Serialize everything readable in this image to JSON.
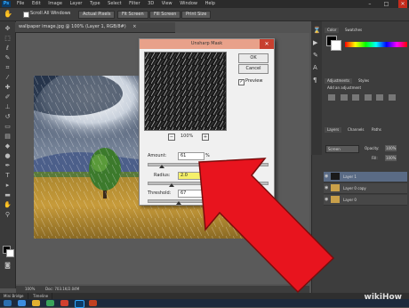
{
  "app": {
    "logo": "Ps",
    "minimize": "–",
    "maximize": "□",
    "close": "✕"
  },
  "menu": [
    "File",
    "Edit",
    "Image",
    "Layer",
    "Type",
    "Select",
    "Filter",
    "3D",
    "View",
    "Window",
    "Help"
  ],
  "options": {
    "scroll_all": "Scroll All Windows",
    "actual_pixels": "Actual Pixels",
    "fit_screen": "Fit Screen",
    "fill_screen": "Fill Screen",
    "print_size": "Print Size"
  },
  "document": {
    "tab_title": "wallpaper image.jpg @ 100% (Layer 1, RGB/8#)",
    "tab_close": "×",
    "status_zoom": "100%",
    "status_doc": "Doc: 703.1K/2.04M"
  },
  "dialog": {
    "title": "Unsharp Mask",
    "ok": "OK",
    "cancel": "Cancel",
    "preview_label": "Preview",
    "preview_checked": true,
    "zoom": "100%",
    "amount_label": "Amount:",
    "amount_value": "61",
    "amount_unit": "%",
    "radius_label": "Radius:",
    "radius_value": "2.0",
    "radius_unit": "Pixels",
    "threshold_label": "Threshold:",
    "threshold_value": "67",
    "threshold_unit": "levels",
    "amount_pos": 0.12,
    "radius_pos": 0.2,
    "threshold_pos": 0.26
  },
  "panels": {
    "color_tab": "Color",
    "swatches_tab": "Swatches",
    "adjustments_tab": "Adjustments",
    "styles_tab": "Styles",
    "add_adjustment": "Add an adjustment",
    "layers_tab": "Layers",
    "channels_tab": "Channels",
    "paths_tab": "Paths",
    "blend_mode": "Screen",
    "opacity_label": "Opacity:",
    "opacity_value": "100%",
    "fill_label": "Fill:",
    "fill_value": "100%",
    "layers": [
      "Layer 1",
      "Layer 0 copy",
      "Layer 0"
    ]
  },
  "bottom_tabs": [
    "Mini Bridge",
    "Timeline"
  ],
  "watermark": "wikiHow",
  "colors": {
    "arrow": "#e8141e",
    "dialog_title": "#e8a18a",
    "workspace": "#535353"
  }
}
